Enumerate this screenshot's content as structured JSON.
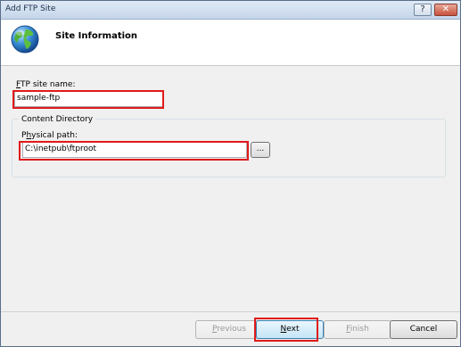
{
  "window": {
    "title": "Add FTP Site"
  },
  "titlebar": {
    "help_glyph": "?",
    "close_glyph": "✕"
  },
  "header": {
    "title": "Site Information",
    "icon": "globe-icon"
  },
  "site_name": {
    "label_mnemonic": "F",
    "label_rest": "TP site name:",
    "value": "sample-ftp"
  },
  "content_dir": {
    "group_label": "Content Directory",
    "path_label_pre": "P",
    "path_label_mnemonic": "h",
    "path_label_rest": "ysical path:",
    "path_value": "C:\\inetpub\\ftproot",
    "browse_label": "..."
  },
  "buttons": {
    "previous": {
      "mnemonic": "P",
      "rest": "revious"
    },
    "next": {
      "mnemonic": "N",
      "rest": "ext"
    },
    "finish": {
      "mnemonic": "F",
      "rest": "inish"
    },
    "cancel": "Cancel"
  },
  "colors": {
    "highlight": "#e01a1a",
    "titlebar": "#c5d6ea"
  }
}
